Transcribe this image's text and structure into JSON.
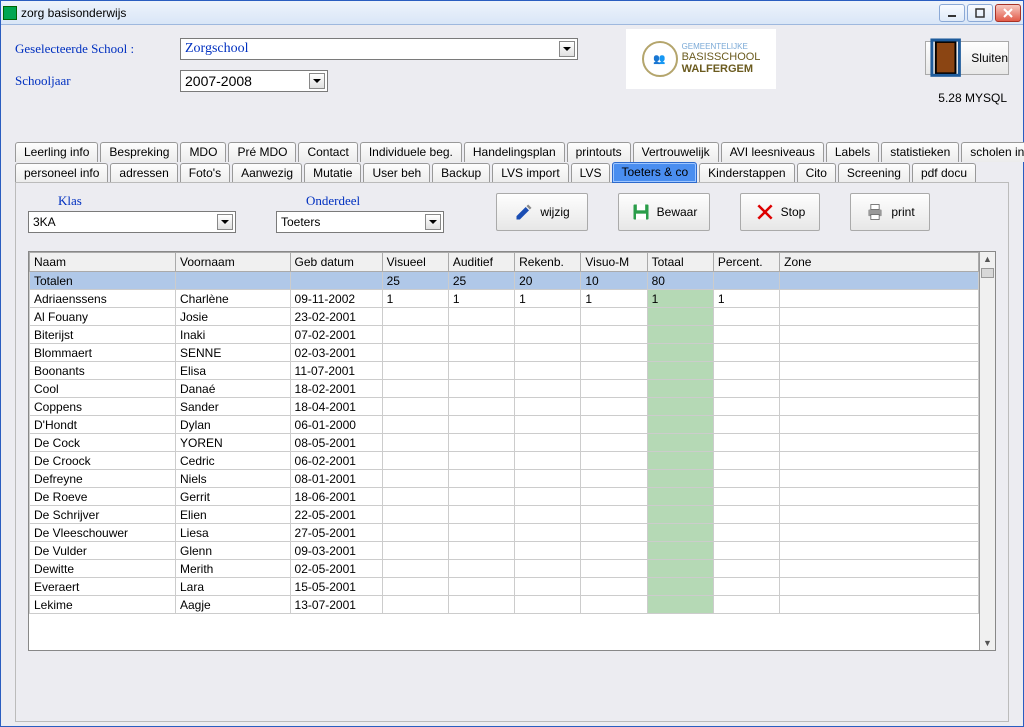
{
  "title": "zorg basisonderwijs",
  "labels": {
    "school": "Geselecteerde School  :",
    "year": "Schooljaar",
    "sluiten": "Sluiten"
  },
  "selects": {
    "school": "Zorgschool",
    "year": "2007-2008",
    "klas": "3KA",
    "onderdeel": "Toeters"
  },
  "filterLabels": {
    "klas": "Klas",
    "onderdeel": "Onderdeel"
  },
  "version": "5.28 MYSQL",
  "logo": {
    "top": "GEMEENTELIJKE",
    "mid": "BASISSCHOOL",
    "name": "WALFERGEM"
  },
  "tabs_row1": [
    "Leerling info",
    "Bespreking",
    "MDO",
    "Pré MDO",
    "Contact",
    "Individuele beg.",
    "Handelingsplan",
    "printouts",
    "Vertrouwelijk",
    "AVI leesniveaus",
    "Labels",
    "statistieken",
    "scholen info"
  ],
  "tabs_row2": [
    "personeel info",
    "adressen",
    "Foto's",
    "Aanwezig",
    "Mutatie",
    "User beh",
    "Backup",
    "LVS import",
    "LVS",
    "Toeters & co",
    "Kinderstappen",
    "Cito",
    "Screening",
    "pdf docu"
  ],
  "active_tab": "Toeters & co",
  "buttons": {
    "wijzig": "wijzig",
    "bewaar": "Bewaar",
    "stop": "Stop",
    "print": "print"
  },
  "columns": [
    "Naam",
    "Voornaam",
    "Geb datum",
    "Visueel",
    "Auditief",
    "Rekenb.",
    "Visuo-M",
    "Totaal",
    "Percent.",
    "Zone"
  ],
  "rows": [
    {
      "naam": "Totalen",
      "voor": "",
      "geb": "",
      "v": "25",
      "a": "25",
      "r": "20",
      "vm": "10",
      "t": "80",
      "p": "",
      "z": ""
    },
    {
      "naam": "Adriaenssens",
      "voor": "Charlène",
      "geb": "09-11-2002",
      "v": "1",
      "a": "1",
      "r": "1",
      "vm": "1",
      "t": "1",
      "p": "1",
      "z": ""
    },
    {
      "naam": "Al Fouany",
      "voor": "Josie",
      "geb": "23-02-2001",
      "v": "",
      "a": "",
      "r": "",
      "vm": "",
      "t": "",
      "p": "",
      "z": ""
    },
    {
      "naam": "Biterijst",
      "voor": "Inaki",
      "geb": "07-02-2001",
      "v": "",
      "a": "",
      "r": "",
      "vm": "",
      "t": "",
      "p": "",
      "z": ""
    },
    {
      "naam": "Blommaert",
      "voor": "SENNE",
      "geb": "02-03-2001",
      "v": "",
      "a": "",
      "r": "",
      "vm": "",
      "t": "",
      "p": "",
      "z": ""
    },
    {
      "naam": "Boonants",
      "voor": "Elisa",
      "geb": "11-07-2001",
      "v": "",
      "a": "",
      "r": "",
      "vm": "",
      "t": "",
      "p": "",
      "z": ""
    },
    {
      "naam": "Cool",
      "voor": "Danaé",
      "geb": "18-02-2001",
      "v": "",
      "a": "",
      "r": "",
      "vm": "",
      "t": "",
      "p": "",
      "z": ""
    },
    {
      "naam": "Coppens",
      "voor": "Sander",
      "geb": "18-04-2001",
      "v": "",
      "a": "",
      "r": "",
      "vm": "",
      "t": "",
      "p": "",
      "z": ""
    },
    {
      "naam": "D'Hondt",
      "voor": "Dylan",
      "geb": "06-01-2000",
      "v": "",
      "a": "",
      "r": "",
      "vm": "",
      "t": "",
      "p": "",
      "z": ""
    },
    {
      "naam": "De Cock",
      "voor": "YOREN",
      "geb": "08-05-2001",
      "v": "",
      "a": "",
      "r": "",
      "vm": "",
      "t": "",
      "p": "",
      "z": ""
    },
    {
      "naam": "De Croock",
      "voor": "Cedric",
      "geb": "06-02-2001",
      "v": "",
      "a": "",
      "r": "",
      "vm": "",
      "t": "",
      "p": "",
      "z": ""
    },
    {
      "naam": "Defreyne",
      "voor": "Niels",
      "geb": "08-01-2001",
      "v": "",
      "a": "",
      "r": "",
      "vm": "",
      "t": "",
      "p": "",
      "z": ""
    },
    {
      "naam": "De Roeve",
      "voor": "Gerrit",
      "geb": "18-06-2001",
      "v": "",
      "a": "",
      "r": "",
      "vm": "",
      "t": "",
      "p": "",
      "z": ""
    },
    {
      "naam": "De Schrijver",
      "voor": "Elien",
      "geb": "22-05-2001",
      "v": "",
      "a": "",
      "r": "",
      "vm": "",
      "t": "",
      "p": "",
      "z": ""
    },
    {
      "naam": "De Vleeschouwer",
      "voor": "Liesa",
      "geb": "27-05-2001",
      "v": "",
      "a": "",
      "r": "",
      "vm": "",
      "t": "",
      "p": "",
      "z": ""
    },
    {
      "naam": "De Vulder",
      "voor": "Glenn",
      "geb": "09-03-2001",
      "v": "",
      "a": "",
      "r": "",
      "vm": "",
      "t": "",
      "p": "",
      "z": ""
    },
    {
      "naam": "Dewitte",
      "voor": "Merith",
      "geb": "02-05-2001",
      "v": "",
      "a": "",
      "r": "",
      "vm": "",
      "t": "",
      "p": "",
      "z": ""
    },
    {
      "naam": "Everaert",
      "voor": "Lara",
      "geb": "15-05-2001",
      "v": "",
      "a": "",
      "r": "",
      "vm": "",
      "t": "",
      "p": "",
      "z": ""
    },
    {
      "naam": "Lekime",
      "voor": "Aagje",
      "geb": "13-07-2001",
      "v": "",
      "a": "",
      "r": "",
      "vm": "",
      "t": "",
      "p": "",
      "z": ""
    }
  ]
}
